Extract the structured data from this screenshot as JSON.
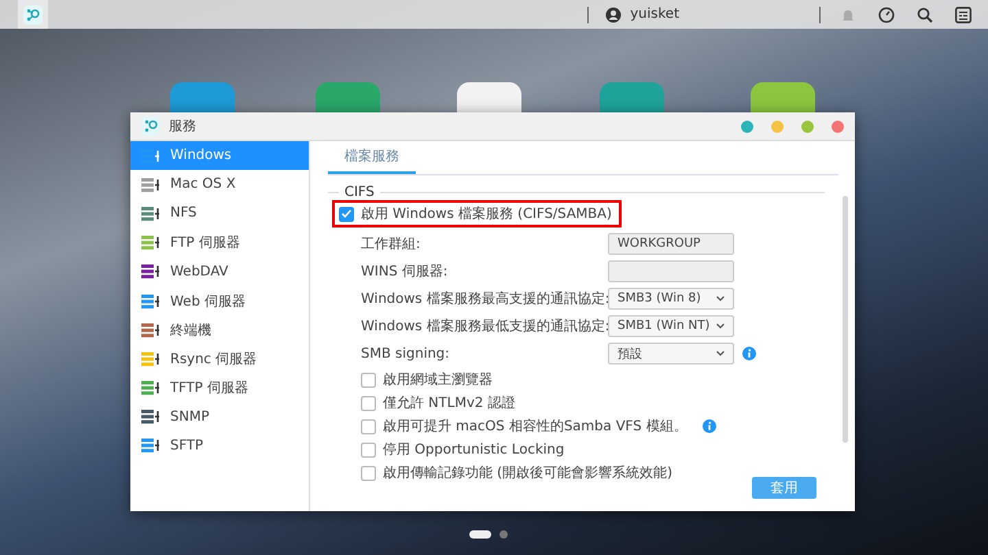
{
  "top_bar": {
    "user": "yuisket"
  },
  "desktop_icons": [
    {
      "color": "#1e9ad6"
    },
    {
      "color": "#2aa86a"
    },
    {
      "color": "#f2f2f2"
    },
    {
      "color": "#1fa39a"
    },
    {
      "color": "#8cc63f"
    }
  ],
  "window": {
    "title": "服務",
    "controls": [
      {
        "color": "#2bb5b8"
      },
      {
        "color": "#f6c244"
      },
      {
        "color": "#9bc53d"
      },
      {
        "color": "#f27474"
      }
    ]
  },
  "sidebar": {
    "items": [
      {
        "label": "Windows",
        "selected": true,
        "color": "#2196f3"
      },
      {
        "label": "Mac OS X",
        "selected": false,
        "color": "#9e9e9e"
      },
      {
        "label": "NFS",
        "selected": false,
        "color": "#5a8a7a"
      },
      {
        "label": "FTP 伺服器",
        "selected": false,
        "color": "#8bc34a"
      },
      {
        "label": "WebDAV",
        "selected": false,
        "color": "#7b1fa2"
      },
      {
        "label": "Web 伺服器",
        "selected": false,
        "color": "#2196f3"
      },
      {
        "label": "終端機",
        "selected": false,
        "color": "#b5654a"
      },
      {
        "label": "Rsync 伺服器",
        "selected": false,
        "color": "#f4c20d"
      },
      {
        "label": "TFTP 伺服器",
        "selected": false,
        "color": "#4caf50"
      },
      {
        "label": "SNMP",
        "selected": false,
        "color": "#455a64"
      },
      {
        "label": "SFTP",
        "selected": false,
        "color": "#2196f3"
      }
    ]
  },
  "tabs": [
    {
      "label": "檔案服務",
      "selected": true
    }
  ],
  "section": {
    "legend": "CIFS",
    "enable": {
      "label": "啟用 Windows 檔案服務 (CIFS/SAMBA)",
      "checked": true,
      "highlighted": true
    },
    "fields": [
      {
        "kind": "text",
        "label": "工作群組:",
        "value": "WORKGROUP",
        "info": false
      },
      {
        "kind": "text",
        "label": "WINS 伺服器:",
        "info": false
      },
      {
        "kind": "select",
        "label": "Windows 檔案服務最高支援的通訊協定:",
        "value": "SMB3 (Win 8)",
        "info": false
      },
      {
        "kind": "select",
        "label": "Windows 檔案服務最低支援的通訊協定:",
        "value": "SMB1 (Win NT)",
        "info": false
      },
      {
        "kind": "select",
        "label": "SMB signing:",
        "value": "預設",
        "info": true
      }
    ],
    "options": [
      {
        "label": "啟用網域主瀏覽器",
        "checked": false,
        "info": false
      },
      {
        "label": "僅允許 NTLMv2 認證",
        "checked": false,
        "info": false
      },
      {
        "label": "啟用可提升 macOS 相容性的Samba VFS 模組。",
        "checked": false,
        "info": true
      },
      {
        "label": "停用 Opportunistic Locking",
        "checked": false,
        "info": false
      },
      {
        "label": "啟用傳輸記錄功能 (開啟後可能會影響系統效能)",
        "checked": false,
        "info": false
      }
    ]
  },
  "apply_button": "套用",
  "page_dots": [
    {
      "selected": true
    },
    {
      "selected": false
    }
  ]
}
